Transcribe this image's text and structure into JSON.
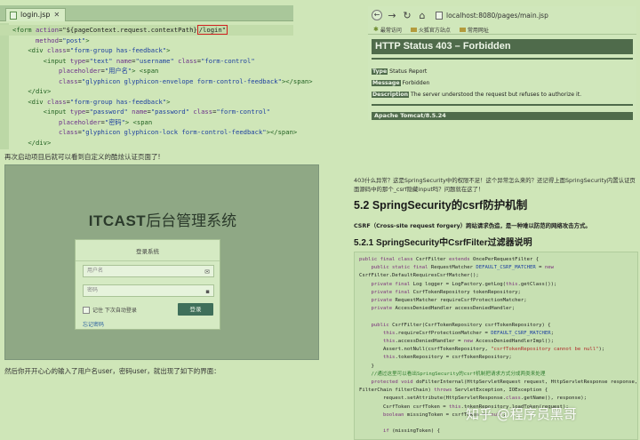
{
  "editor": {
    "tab": "login.jsp",
    "code": [
      [
        [
          "t-tag",
          "<form "
        ],
        [
          "t-attr",
          "action"
        ],
        [
          "t-plain",
          "=\"${"
        ],
        [
          "t-plain",
          "pageContext.request.contextPath}"
        ],
        [
          "boxed",
          "/login\""
        ]
      ],
      [
        [
          "t-plain",
          "      "
        ],
        [
          "t-attr",
          "method"
        ],
        [
          "t-plain",
          "="
        ],
        [
          "t-str",
          "\"post\""
        ],
        [
          "t-tag",
          ">"
        ]
      ],
      [
        [
          "t-plain",
          "    "
        ],
        [
          "t-tag",
          "<div "
        ],
        [
          "t-attr",
          "class"
        ],
        [
          "t-plain",
          "="
        ],
        [
          "t-str",
          "\"form-group has-feedback\""
        ],
        [
          "t-tag",
          ">"
        ]
      ],
      [
        [
          "t-plain",
          "        "
        ],
        [
          "t-tag",
          "<input "
        ],
        [
          "t-attr",
          "type"
        ],
        [
          "t-plain",
          "="
        ],
        [
          "t-str",
          "\"text\" "
        ],
        [
          "t-attr",
          "name"
        ],
        [
          "t-plain",
          "="
        ],
        [
          "t-str",
          "\"username\" "
        ],
        [
          "t-attr",
          "class"
        ],
        [
          "t-plain",
          "="
        ],
        [
          "t-str",
          "\"form-control\""
        ]
      ],
      [
        [
          "t-plain",
          "            "
        ],
        [
          "t-attr",
          "placeholder"
        ],
        [
          "t-plain",
          "="
        ],
        [
          "t-str",
          "\"用户名\""
        ],
        [
          "t-tag",
          "> <span"
        ]
      ],
      [
        [
          "t-plain",
          "            "
        ],
        [
          "t-attr",
          "class"
        ],
        [
          "t-plain",
          "="
        ],
        [
          "t-str",
          "\"glyphicon glyphicon-envelope form-control-feedback\""
        ],
        [
          "t-tag",
          "></span>"
        ]
      ],
      [
        [
          "t-plain",
          "    "
        ],
        [
          "t-tag",
          "</div>"
        ]
      ],
      [
        [
          "t-plain",
          "    "
        ],
        [
          "t-tag",
          "<div "
        ],
        [
          "t-attr",
          "class"
        ],
        [
          "t-plain",
          "="
        ],
        [
          "t-str",
          "\"form-group has-feedback\""
        ],
        [
          "t-tag",
          ">"
        ]
      ],
      [
        [
          "t-plain",
          "        "
        ],
        [
          "t-tag",
          "<input "
        ],
        [
          "t-attr",
          "type"
        ],
        [
          "t-plain",
          "="
        ],
        [
          "t-str",
          "\"password\" "
        ],
        [
          "t-attr",
          "name"
        ],
        [
          "t-plain",
          "="
        ],
        [
          "t-str",
          "\"password\" "
        ],
        [
          "t-attr",
          "class"
        ],
        [
          "t-plain",
          "="
        ],
        [
          "t-str",
          "\"form-control\""
        ]
      ],
      [
        [
          "t-plain",
          "            "
        ],
        [
          "t-attr",
          "placeholder"
        ],
        [
          "t-plain",
          "="
        ],
        [
          "t-str",
          "\"密码\""
        ],
        [
          "t-tag",
          "> <span"
        ]
      ],
      [
        [
          "t-plain",
          "            "
        ],
        [
          "t-attr",
          "class"
        ],
        [
          "t-plain",
          "="
        ],
        [
          "t-str",
          "\"glyphicon glyphicon-lock form-control-feedback\""
        ],
        [
          "t-tag",
          "></span>"
        ]
      ],
      [
        [
          "t-plain",
          "    "
        ],
        [
          "t-tag",
          "</div>"
        ]
      ]
    ]
  },
  "caption1": "再次启动项目后就可以看到自定义的酷炫认证页面了!",
  "login": {
    "brand_bold": "ITCAST",
    "brand_rest": "后台管理系统",
    "box_title": "登录系统",
    "username_placeholder": "用户名",
    "password_placeholder": "密码",
    "remember": "记住 下次自动登录",
    "button": "登录",
    "forgot": "忘记密码"
  },
  "caption2": "然后你开开心心的输入了用户名user，密码user，就出现了如下的界面：",
  "browser": {
    "url": "localhost:8080/pages/main.jsp",
    "bookmarks": [
      "最常访问",
      "火狐官方站点",
      "常用网址"
    ],
    "status_title": "HTTP Status 403 – Forbidden",
    "rows": [
      {
        "key": "Type",
        "value": "Status Report"
      },
      {
        "key": "Message",
        "value": "Forbidden"
      },
      {
        "key": "Description",
        "value": "The server understood the request but refuses to authorize it."
      }
    ],
    "footer": "Apache Tomcat/8.5.24"
  },
  "article": {
    "para": "403什么异常？这是SpringSecurity中的权限不足！这个异常怎么来的？还记得上面SpringSecurity内置认证页面源码中的那个_csrf隐藏input吗？问题就在这了！",
    "h2": "5.2 SpringSecurity的csrf防护机制",
    "csrf": "CSRF（Cross-site request forgery）跨站请求伪造，是一种难以防范的网络攻击方式。",
    "h3": "5.2.1 SpringSecurity中CsrfFilter过滤器说明"
  },
  "java": [
    [
      [
        "k1",
        "public final class "
      ],
      [
        "t-plain",
        "CsrfFilter "
      ],
      [
        "k1",
        "extends "
      ],
      [
        "t-plain",
        "OncePerRequestFilter {"
      ]
    ],
    [
      [
        "t-plain",
        "    "
      ],
      [
        "k1",
        "public static final "
      ],
      [
        "t-plain",
        "RequestMatcher "
      ],
      [
        "k2",
        "DEFAULT_CSRF_MATCHER"
      ],
      [
        "t-plain",
        " = "
      ],
      [
        "k1",
        "new"
      ]
    ],
    [
      [
        "t-plain",
        "CsrfFilter.DefaultRequiresCsrfMatcher();"
      ]
    ],
    [
      [
        "t-plain",
        "    "
      ],
      [
        "k1",
        "private final "
      ],
      [
        "t-plain",
        "Log logger = LogFactory.getLog("
      ],
      [
        "k1",
        "this"
      ],
      [
        "t-plain",
        ".getClass());"
      ]
    ],
    [
      [
        "t-plain",
        "    "
      ],
      [
        "k1",
        "private final "
      ],
      [
        "t-plain",
        "CsrfTokenRepository tokenRepository;"
      ]
    ],
    [
      [
        "t-plain",
        "    "
      ],
      [
        "k1",
        "private "
      ],
      [
        "t-plain",
        "RequestMatcher requireCsrfProtectionMatcher;"
      ]
    ],
    [
      [
        "t-plain",
        "    "
      ],
      [
        "k1",
        "private "
      ],
      [
        "t-plain",
        "AccessDeniedHandler accessDeniedHandler;"
      ]
    ],
    [
      [
        "t-plain",
        ""
      ]
    ],
    [
      [
        "t-plain",
        "    "
      ],
      [
        "k1",
        "public "
      ],
      [
        "t-plain",
        "CsrfFilter(CsrfTokenRepository csrfTokenRepository) {"
      ]
    ],
    [
      [
        "t-plain",
        "        "
      ],
      [
        "k1",
        "this"
      ],
      [
        "t-plain",
        ".requireCsrfProtectionMatcher = "
      ],
      [
        "k2",
        "DEFAULT_CSRF_MATCHER"
      ],
      [
        "t-plain",
        ";"
      ]
    ],
    [
      [
        "t-plain",
        "        "
      ],
      [
        "k1",
        "this"
      ],
      [
        "t-plain",
        ".accessDeniedHandler = "
      ],
      [
        "k1",
        "new "
      ],
      [
        "t-plain",
        "AccessDeniedHandlerImpl();"
      ]
    ],
    [
      [
        "t-plain",
        "        Assert.notNull(csrfTokenRepository, "
      ],
      [
        "st",
        "\"csrfTokenRepository cannot be null\""
      ],
      [
        "t-plain",
        ");"
      ]
    ],
    [
      [
        "t-plain",
        "        "
      ],
      [
        "k1",
        "this"
      ],
      [
        "t-plain",
        ".tokenRepository = csrfTokenRepository;"
      ]
    ],
    [
      [
        "t-plain",
        "    }"
      ]
    ],
    [
      [
        "cm",
        "    //通过这里可以看出SpringSecurity的csrf机制把请求方式分成两类来处理"
      ]
    ],
    [
      [
        "t-plain",
        "    "
      ],
      [
        "k1",
        "protected void "
      ],
      [
        "t-plain",
        "doFilterInternal(HttpServletRequest request, HttpServletResponse response,"
      ]
    ],
    [
      [
        "t-plain",
        "FilterChain filterChain) "
      ],
      [
        "k1",
        "throws "
      ],
      [
        "t-plain",
        "ServletException, IOException {"
      ]
    ],
    [
      [
        "t-plain",
        "        request.setAttribute(HttpServletResponse."
      ],
      [
        "k1",
        "class"
      ],
      [
        "t-plain",
        ".getName(), response);"
      ]
    ],
    [
      [
        "t-plain",
        "        CsrfToken csrfToken = "
      ],
      [
        "k1",
        "this"
      ],
      [
        "t-plain",
        ".tokenRepository.loadToken(request);"
      ]
    ],
    [
      [
        "t-plain",
        "        "
      ],
      [
        "k1",
        "boolean "
      ],
      [
        "t-plain",
        "missingToken = csrfToken == "
      ],
      [
        "k1",
        "null"
      ],
      [
        "t-plain",
        ";"
      ]
    ],
    [
      [
        "t-plain",
        ""
      ]
    ],
    [
      [
        "t-plain",
        "        "
      ],
      [
        "k1",
        "if "
      ],
      [
        "t-plain",
        "(missingToken) {"
      ]
    ]
  ],
  "watermark": "知乎 @程序员黑哥"
}
